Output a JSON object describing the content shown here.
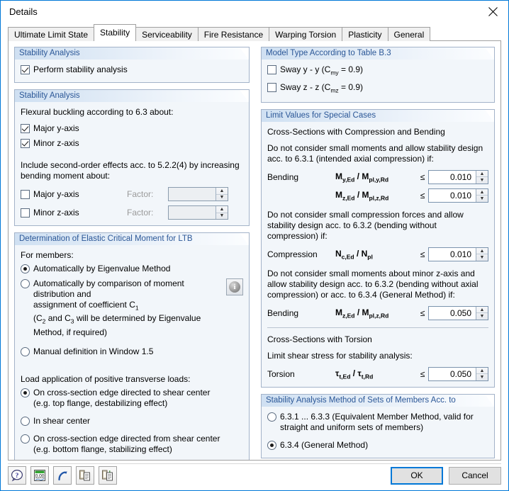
{
  "window": {
    "title": "Details",
    "close_label": "close-icon"
  },
  "tabs": [
    {
      "label": "Ultimate Limit State",
      "active": false
    },
    {
      "label": "Stability",
      "active": true
    },
    {
      "label": "Serviceability",
      "active": false
    },
    {
      "label": "Fire Resistance",
      "active": false
    },
    {
      "label": "Warping Torsion",
      "active": false
    },
    {
      "label": "Plasticity",
      "active": false
    },
    {
      "label": "General",
      "active": false
    }
  ],
  "left": {
    "group1": {
      "header": "Stability Analysis",
      "perform": {
        "label": "Perform stability analysis",
        "checked": true
      }
    },
    "group2": {
      "header": "Stability Analysis",
      "flexural_label": "Flexural buckling according to 6.3 about:",
      "major_y": {
        "label": "Major y-axis",
        "checked": true
      },
      "minor_z": {
        "label": "Minor z-axis",
        "checked": true
      },
      "second_order_label": "Include second-order effects acc. to 5.2.2(4) by increasing bending moment about:",
      "so_major_y": {
        "label": "Major y-axis",
        "checked": false,
        "factor_label": "Factor:",
        "factor_value": "",
        "disabled": true
      },
      "so_minor_z": {
        "label": "Minor z-axis",
        "checked": false,
        "factor_label": "Factor:",
        "factor_value": "",
        "disabled": true
      }
    },
    "group3": {
      "header": "Determination of Elastic Critical Moment for LTB",
      "for_members_label": "For members:",
      "opt1": {
        "label": "Automatically by Eigenvalue Method",
        "selected": true
      },
      "opt2": {
        "line1": "Automatically by comparison of moment distribution and",
        "line2_pre": "assignment of coefficient C",
        "line2_sub": "1",
        "line3_pre": "(C",
        "line3_sub1": "2",
        "line3_mid": " and C",
        "line3_sub2": "3",
        "line3_post": " will be determined by Eigenvalue",
        "line4": "Method, if required)",
        "selected": false
      },
      "opt3": {
        "label": "Manual definition in Window 1.5",
        "selected": false
      },
      "info_button": "info-icon",
      "load_app_label": "Load application of positive transverse loads:",
      "load1": {
        "line1": "On cross-section edge directed to shear center",
        "line2": "(e.g. top flange, destabilizing effect)",
        "selected": true
      },
      "load2": {
        "line1": "In shear center",
        "selected": false
      },
      "load3": {
        "line1": "On cross-section edge directed from shear center",
        "line2": "(e.g. bottom flange, stabilizing effect)",
        "selected": false
      }
    }
  },
  "right": {
    "group1": {
      "header": "Model Type According to Table B.3",
      "sway_y": {
        "pre": "Sway y - y (C",
        "sub": "my",
        "post": " = 0.9)",
        "checked": false
      },
      "sway_z": {
        "pre": "Sway z - z (C",
        "sub": "mz",
        "post": " = 0.9)",
        "checked": false
      }
    },
    "group2": {
      "header": "Limit Values for Special Cases",
      "subtitle1": "Cross-Sections with Compression and Bending",
      "note1": "Do not consider small moments and allow stability design acc. to 6.3.1 (intended axial compression) if:",
      "bending_label": "Bending",
      "row1": {
        "formula": "My,Ed / Mpl,y,Rd",
        "le": "≤",
        "value": "0.010"
      },
      "row2": {
        "formula": "Mz,Ed / Mpl,z,Rd",
        "le": "≤",
        "value": "0.010"
      },
      "note2": "Do not consider small compression forces and allow stability design acc. to 6.3.2 (bending without compression) if:",
      "compression_label": "Compression",
      "row3": {
        "formula": "Nc,Ed / Npl",
        "le": "≤",
        "value": "0.010"
      },
      "note3": "Do not consider small moments about minor z-axis and allow stability design acc. to 6.3.2 (bending without axial compression) or acc. to 6.3.4 (General Method) if:",
      "bending_label2": "Bending",
      "row4": {
        "formula": "Mz,Ed / Mpl,z,Rd",
        "le": "≤",
        "value": "0.050"
      },
      "subtitle2": "Cross-Sections with Torsion",
      "note4": "Limit shear stress for stability analysis:",
      "torsion_label": "Torsion",
      "row5": {
        "formula": "τt,Ed / τt,Rd",
        "le": "≤",
        "value": "0.050"
      }
    },
    "group3": {
      "header": "Stability Analysis Method of Sets of Members Acc. to",
      "opt1": {
        "line1": "6.3.1 ... 6.3.3 (Equivalent Member Method, valid for",
        "line2": "straight and uniform sets of members)",
        "selected": false
      },
      "opt2": {
        "line1": "6.3.4  (General Method)",
        "selected": true
      }
    }
  },
  "footer": {
    "tools": [
      {
        "name": "help-icon"
      },
      {
        "name": "units-icon"
      },
      {
        "name": "undo-icon"
      },
      {
        "name": "copy-icon"
      },
      {
        "name": "paste-icon"
      }
    ],
    "ok_label": "OK",
    "cancel_label": "Cancel"
  }
}
